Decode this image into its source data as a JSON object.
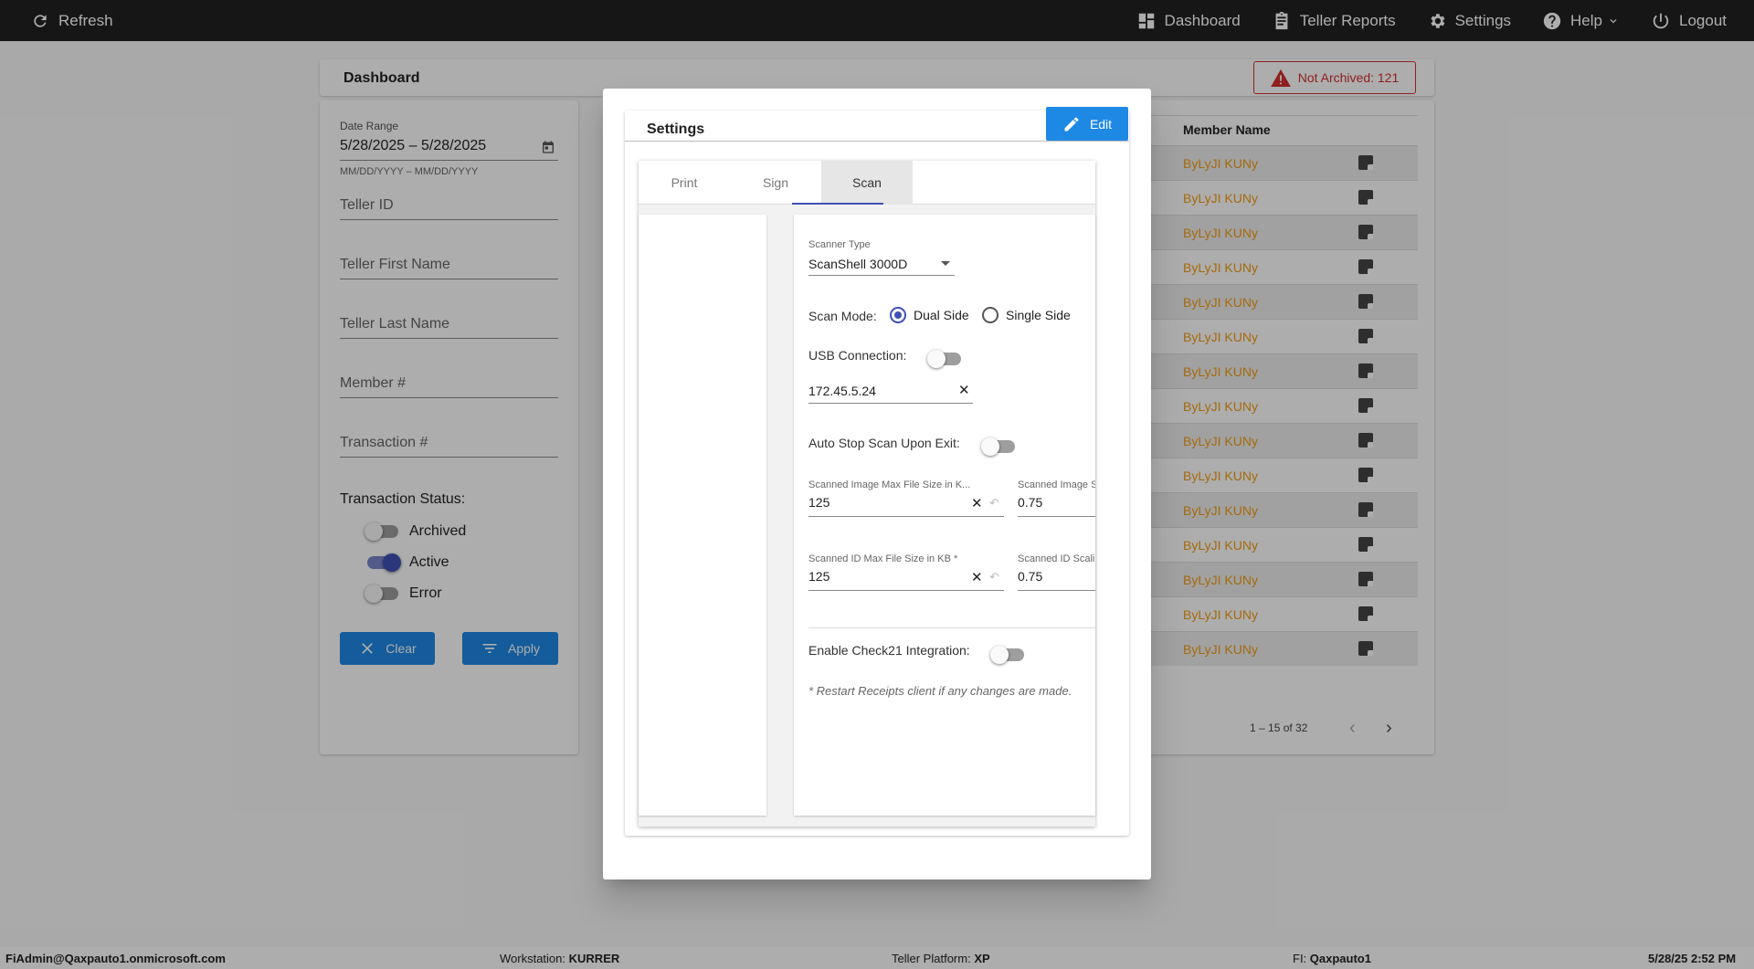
{
  "topbar": {
    "refresh_label": "Refresh",
    "nav": [
      {
        "label": "Dashboard",
        "icon": "dashboard-icon"
      },
      {
        "label": "Teller Reports",
        "icon": "clipboard-icon"
      },
      {
        "label": "Settings",
        "icon": "gear-icon"
      },
      {
        "label": "Help",
        "icon": "help-icon"
      },
      {
        "label": "Logout",
        "icon": "power-icon"
      }
    ]
  },
  "dashboard": {
    "title": "Dashboard",
    "not_archived": "Not Archived: 121"
  },
  "filters": {
    "date_range_label": "Date Range",
    "date_range_value": "5/28/2025 – 5/28/2025",
    "date_range_hint": "MM/DD/YYYY – MM/DD/YYYY",
    "teller_id": "Teller ID",
    "teller_first_name": "Teller First Name",
    "teller_last_name": "Teller Last Name",
    "member_no": "Member #",
    "transaction_no": "Transaction #",
    "status_title": "Transaction Status:",
    "statuses": [
      {
        "label": "Archived",
        "on": false
      },
      {
        "label": "Active",
        "on": true
      },
      {
        "label": "Error",
        "on": false
      }
    ],
    "clear_label": "Clear",
    "apply_label": "Apply"
  },
  "table": {
    "header": "Member Name",
    "rows": [
      "ByLyJI KUNy",
      "ByLyJI KUNy",
      "ByLyJI KUNy",
      "ByLyJI KUNy",
      "ByLyJI KUNy",
      "ByLyJI KUNy",
      "ByLyJI KUNy",
      "ByLyJI KUNy",
      "ByLyJI KUNy",
      "ByLyJI KUNy",
      "ByLyJI KUNy",
      "ByLyJI KUNy",
      "ByLyJI KUNy",
      "ByLyJI KUNy",
      "ByLyJI KUNy"
    ],
    "pager": "1 – 15 of 32"
  },
  "footer": {
    "user": "FiAdmin@Qaxpauto1.onmicrosoft.com",
    "workstation_label": "Workstation:",
    "workstation": "KURRER",
    "platform_label": "Teller Platform:",
    "platform": "XP",
    "fi_label": "FI:",
    "fi": "Qaxpauto1",
    "datetime": "5/28/25 2:52 PM"
  },
  "modal": {
    "title": "Settings",
    "edit_label": "Edit",
    "tabs": [
      "Print",
      "Sign",
      "Scan"
    ],
    "active_tab": "Scan",
    "scan": {
      "scanner_type_label": "Scanner Type",
      "scanner_type_value": "ScanShell 3000D",
      "scan_mode_label": "Scan Mode:",
      "scan_mode_options": [
        "Dual Side",
        "Single Side"
      ],
      "usb_label": "USB Connection:",
      "ip_value": "172.45.5.24",
      "auto_stop_label": "Auto Stop Scan Upon Exit:",
      "img_max_label": "Scanned Image Max File Size in K...",
      "img_max_value": "125",
      "img_scale_label": "Scanned Image Sc",
      "img_scale_value": "0.75",
      "id_max_label": "Scanned ID Max File Size in KB *",
      "id_max_value": "125",
      "id_scale_label": "Scanned ID Scalin",
      "id_scale_value": "0.75",
      "check21_label": "Enable Check21 Integration:",
      "note": "* Restart Receipts client if any changes are made."
    }
  }
}
